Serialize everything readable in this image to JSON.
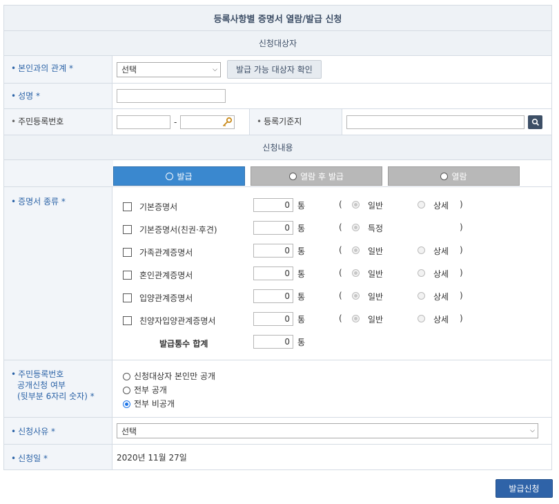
{
  "title": "등록사항별 증명서 열람/발급 신청",
  "sections": {
    "target": "신청대상자",
    "content": "신청내용"
  },
  "relation": {
    "label": "본인과의 관계 *",
    "select_value": "선택",
    "check_button": "발급 가능 대상자 확인"
  },
  "name": {
    "label": "성명 *",
    "value": ""
  },
  "resident_number": {
    "label": "주민등록번호",
    "separator": "-",
    "part1": "",
    "part2": ""
  },
  "registry": {
    "label": "등록기준지",
    "value": ""
  },
  "tabs": [
    {
      "label": "발급",
      "active": true
    },
    {
      "label": "열람 후 발급",
      "active": false
    },
    {
      "label": "열람",
      "active": false
    }
  ],
  "certificates": {
    "label": "증명서 종류 *",
    "unit": "통",
    "open_paren": "(",
    "close_paren": ")",
    "items": [
      {
        "name": "기본증명서",
        "qty": "0",
        "opt1": "일반",
        "opt2": "상세"
      },
      {
        "name": "기본증명서(친권·후견)",
        "qty": "0",
        "opt1": "특정",
        "opt2": ""
      },
      {
        "name": "가족관계증명서",
        "qty": "0",
        "opt1": "일반",
        "opt2": "상세"
      },
      {
        "name": "혼인관계증명서",
        "qty": "0",
        "opt1": "일반",
        "opt2": "상세"
      },
      {
        "name": "입양관계증명서",
        "qty": "0",
        "opt1": "일반",
        "opt2": "상세"
      },
      {
        "name": "친양자입양관계증명서",
        "qty": "0",
        "opt1": "일반",
        "opt2": "상세"
      }
    ],
    "total_label": "발급통수 합계",
    "total_qty": "0"
  },
  "disclosure": {
    "label_line1": "주민등록번호",
    "label_line2": "공개신청 여부",
    "label_line3": "(뒷부분 6자리 숫자) *",
    "options": [
      "신청대상자 본인만 공개",
      "전부 공개",
      "전부 비공개"
    ],
    "selected": "전부 비공개"
  },
  "reason": {
    "label": "신청사유 *",
    "select_value": "선택"
  },
  "date": {
    "label": "신청일 *",
    "value": "2020년 11월 27일"
  },
  "submit_label": "발급신청",
  "colors": {
    "accent": "#3a88cf",
    "label_text": "#2a62a6",
    "submit": "#2f63a8"
  },
  "icons": {
    "search": "search-icon",
    "key": "key-icon"
  }
}
